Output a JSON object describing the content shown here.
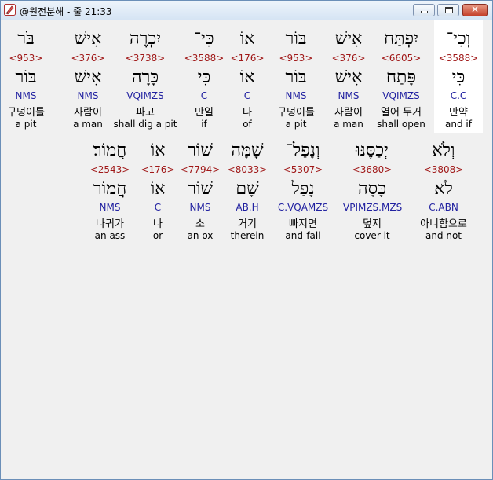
{
  "window": {
    "title": "@원전분해 - 줄 21:33",
    "buttons": {
      "minimize": "minimize",
      "maximize": "maximize",
      "close": "✕"
    },
    "app_icon": "pencil-icon"
  },
  "colors": {
    "strongs": "#a01818",
    "morph": "#2020a0",
    "highlight": "#ffffff"
  },
  "row1": [
    {
      "heb": "בֹּר",
      "strongs": "<953>",
      "lemma": "בּוֹר",
      "morph": "NMS",
      "kor": "구덩이를",
      "eng": "a pit"
    },
    {
      "heb": "אִישׁ",
      "strongs": "<376>",
      "lemma": "אִישׁ",
      "morph": "NMS",
      "kor": "사람이",
      "eng": "a man"
    },
    {
      "heb": "יִכְרֶה",
      "strongs": "<3738>",
      "lemma": "כָּרָה",
      "morph": "VQIMZS",
      "kor": "파고",
      "eng": "shall dig a pit"
    },
    {
      "heb": "כִּי־",
      "strongs": "<3588>",
      "lemma": "כִּי",
      "morph": "C",
      "kor": "만일",
      "eng": "if"
    },
    {
      "heb": "אוֹ",
      "strongs": "<176>",
      "lemma": "אוֹ",
      "morph": "C",
      "kor": "나",
      "eng": "of"
    },
    {
      "heb": "בּוֹר",
      "strongs": "<953>",
      "lemma": "בּוֹר",
      "morph": "NMS",
      "kor": "구덩이를",
      "eng": "a pit"
    },
    {
      "heb": "אִישׁ",
      "strongs": "<376>",
      "lemma": "אִישׁ",
      "morph": "NMS",
      "kor": "사람이",
      "eng": "a man"
    },
    {
      "heb": "יִפְתַּח",
      "strongs": "<6605>",
      "lemma": "פָּתַח",
      "morph": "VQIMZS",
      "kor": "열어 두거",
      "eng": "shall open"
    },
    {
      "heb": "וְכִי־",
      "strongs": "<3588>",
      "lemma": "כִּי",
      "morph": "C.C",
      "kor": "만약",
      "eng": "and if"
    }
  ],
  "row2": [
    {
      "heb": "חֲמוֹר׃",
      "strongs": "<2543>",
      "lemma": "חֲמוֹר",
      "morph": "NMS",
      "kor": "나귀가",
      "eng": "an ass"
    },
    {
      "heb": "אוֹ",
      "strongs": "<176>",
      "lemma": "אוֹ",
      "morph": "C",
      "kor": "나",
      "eng": "or"
    },
    {
      "heb": "שׁוֹר",
      "strongs": "<7794>",
      "lemma": "שׁוֹר",
      "morph": "NMS",
      "kor": "소",
      "eng": "an ox"
    },
    {
      "heb": "שָׁמָּה",
      "strongs": "<8033>",
      "lemma": "שָׁם",
      "morph": "AB.H",
      "kor": "거기",
      "eng": "therein"
    },
    {
      "heb": "וְנָפַל־",
      "strongs": "<5307>",
      "lemma": "נָפַל",
      "morph": "C.VQAMZS",
      "kor": "빠지면",
      "eng": "and-fall"
    },
    {
      "heb": "יְכַסֶּנּוּ",
      "strongs": "<3680>",
      "lemma": "כָּסָה",
      "morph": "VPIMZS.MZS",
      "kor": "덮지",
      "eng": "cover it"
    },
    {
      "heb": "וְלֹא",
      "strongs": "<3808>",
      "lemma": "לֹא",
      "morph": "C.ABN",
      "kor": "아니함으로",
      "eng": "and not"
    }
  ]
}
